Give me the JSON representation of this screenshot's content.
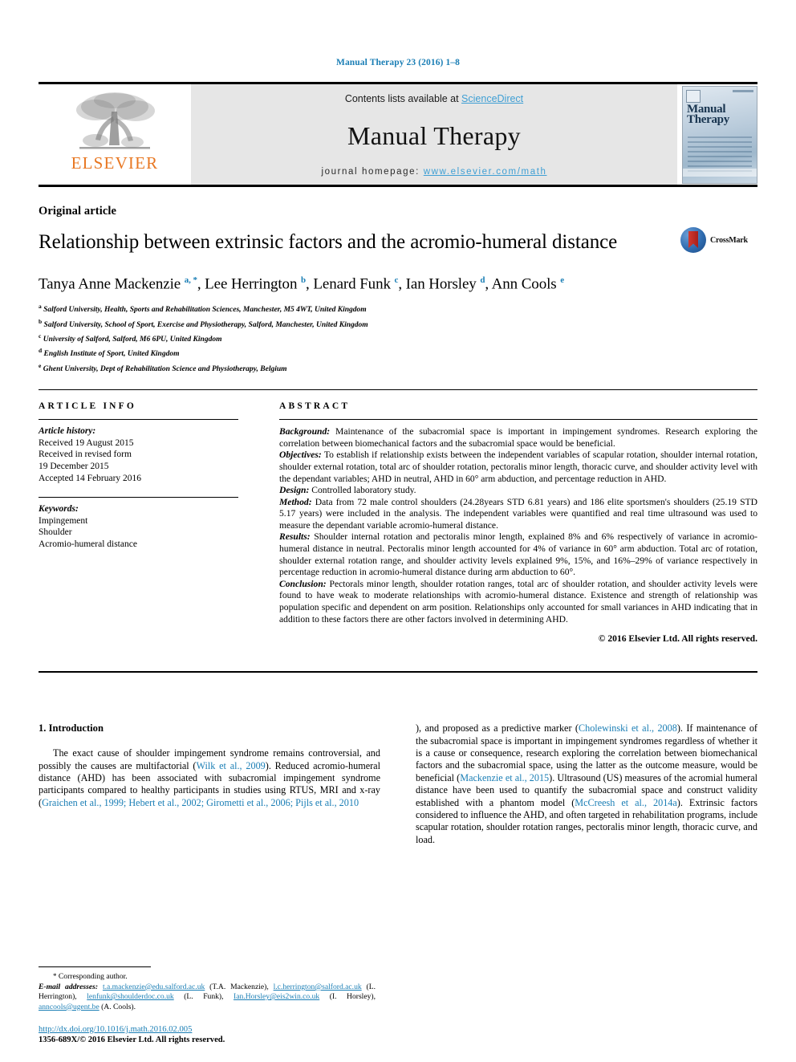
{
  "running_head": "Manual Therapy 23 (2016) 1–8",
  "masthead": {
    "publisher": "ELSEVIER",
    "contents_prefix": "Contents lists available at ",
    "contents_link": "ScienceDirect",
    "journal_name": "Manual Therapy",
    "homepage_prefix": "journal homepage: ",
    "homepage_url": "www.elsevier.com/math",
    "cover_title": "Manual Therapy"
  },
  "article": {
    "type": "Original article",
    "title": "Relationship between extrinsic factors and the acromio-humeral distance",
    "crossmark_label": "CrossMark",
    "authors": [
      {
        "name": "Tanya Anne Mackenzie",
        "sup": "a, *"
      },
      {
        "name": "Lee Herrington",
        "sup": "b"
      },
      {
        "name": "Lenard Funk",
        "sup": "c"
      },
      {
        "name": "Ian Horsley",
        "sup": "d"
      },
      {
        "name": "Ann Cools",
        "sup": "e"
      }
    ],
    "affiliations": [
      {
        "marker": "a",
        "text": "Salford University, Health, Sports and Rehabilitation Sciences, Manchester, M5 4WT, United Kingdom"
      },
      {
        "marker": "b",
        "text": "Salford University, School of Sport, Exercise and Physiotherapy, Salford, Manchester, United Kingdom"
      },
      {
        "marker": "c",
        "text": "University of Salford, Salford, M6 6PU, United Kingdom"
      },
      {
        "marker": "d",
        "text": "English Institute of Sport, United Kingdom"
      },
      {
        "marker": "e",
        "text": "Ghent University, Dept of Rehabilitation Science and Physiotherapy, Belgium"
      }
    ]
  },
  "info": {
    "heading": "ARTICLE INFO",
    "history_label": "Article history:",
    "history": [
      "Received 19 August 2015",
      "Received in revised form",
      "19 December 2015",
      "Accepted 14 February 2016"
    ],
    "keywords_label": "Keywords:",
    "keywords": [
      "Impingement",
      "Shoulder",
      "Acromio-humeral distance"
    ]
  },
  "abstract": {
    "heading": "ABSTRACT",
    "sections": [
      {
        "label": "Background:",
        "text": " Maintenance of the subacromial space is important in impingement syndromes. Research exploring the correlation between biomechanical factors and the subacromial space would be beneficial."
      },
      {
        "label": "Objectives:",
        "text": " To establish if relationship exists between the independent variables of scapular rotation, shoulder internal rotation, shoulder external rotation, total arc of shoulder rotation, pectoralis minor length, thoracic curve, and shoulder activity level with the dependant variables; AHD in neutral, AHD in 60° arm abduction, and percentage reduction in AHD."
      },
      {
        "label": "Design:",
        "text": " Controlled laboratory study."
      },
      {
        "label": "Method:",
        "text": " Data from 72 male control shoulders (24.28years STD 6.81 years) and 186 elite sportsmen's shoulders (25.19 STD 5.17 years) were included in the analysis. The independent variables were quantified and real time ultrasound was used to measure the dependant variable acromio-humeral distance."
      },
      {
        "label": "Results:",
        "text": " Shoulder internal rotation and pectoralis minor length, explained 8% and 6% respectively of variance in acromio-humeral distance in neutral. Pectoralis minor length accounted for 4% of variance in 60° arm abduction. Total arc of rotation, shoulder external rotation range, and shoulder activity levels explained 9%, 15%, and 16%–29% of variance respectively in percentage reduction in acromio-humeral distance during arm abduction to 60°."
      },
      {
        "label": "Conclusion:",
        "text": " Pectorals minor length, shoulder rotation ranges, total arc of shoulder rotation, and shoulder activity levels were found to have weak to moderate relationships with acromio-humeral distance. Existence and strength of relationship was population specific and dependent on arm position. Relationships only accounted for small variances in AHD indicating that in addition to these factors there are other factors involved in determining AHD."
      }
    ],
    "copyright": "© 2016 Elsevier Ltd. All rights reserved."
  },
  "body": {
    "section_title": "1. Introduction",
    "left_paragraph_parts": [
      {
        "t": "The exact cause of shoulder impingement syndrome remains controversial, and possibly the causes are multifactorial (",
        "ref": false
      },
      {
        "t": "Wilk et al., 2009",
        "ref": true
      },
      {
        "t": "). Reduced acromio-humeral distance (AHD) has been associated with subacromial impingement syndrome participants compared to healthy participants in studies using RTUS, MRI and x-ray (",
        "ref": false
      },
      {
        "t": "Graichen et al., 1999; Hebert et al., 2002; Girometti et al., 2006; Pijls et al., 2010",
        "ref": true
      },
      {
        "t": "), and proposed as a predictive marker (",
        "ref": false
      },
      {
        "t": "Cholewinski et al., 2008",
        "ref": true
      },
      {
        "t": "). If maintenance of the subacromial space is important in impingement syndromes regardless of whether it is a cause or consequence, research exploring the correlation between biomechanical factors and the subacromial space, using the latter as the outcome measure, would be beneficial (",
        "ref": false
      },
      {
        "t": "Mackenzie et al., 2015",
        "ref": true
      },
      {
        "t": "). Ultrasound (US) measures of the acromial humeral distance have been used to quantify the subacromial space and construct validity established with a phantom model (",
        "ref": false
      },
      {
        "t": "McCreesh et al., 2014a",
        "ref": true
      },
      {
        "t": "). Extrinsic factors considered to influence the AHD, and often targeted in rehabilitation programs, include scapular rotation, shoulder rotation ranges, pectoralis minor length, thoracic curve, and load.",
        "ref": false
      }
    ]
  },
  "footnote": {
    "corresponding_star": "*",
    "corresponding_label": "Corresponding author.",
    "emails_label": "E-mail addresses:",
    "emails": [
      {
        "address": "t.a.mackenzie@edu.salford.ac.uk",
        "owner": " (T.A. Mackenzie), "
      },
      {
        "address": "l.c.herrington@salford.ac.uk",
        "owner": " (L. Herrington), "
      },
      {
        "address": "lenfunk@shoulderdoc.co.uk",
        "owner": " (L. Funk), "
      },
      {
        "address": "Ian.Horsley@eis2win.co.uk",
        "owner": " (I. Horsley), "
      },
      {
        "address": "anncools@ugent.be",
        "owner": " (A. Cools)."
      }
    ],
    "doi": "http://dx.doi.org/10.1016/j.math.2016.02.005",
    "issn": "1356-689X/© 2016 Elsevier Ltd. All rights reserved."
  },
  "colors": {
    "link": "#1a7eb5",
    "elsevier_orange": "#e87722",
    "masthead_bg": "#e6e6e6"
  }
}
